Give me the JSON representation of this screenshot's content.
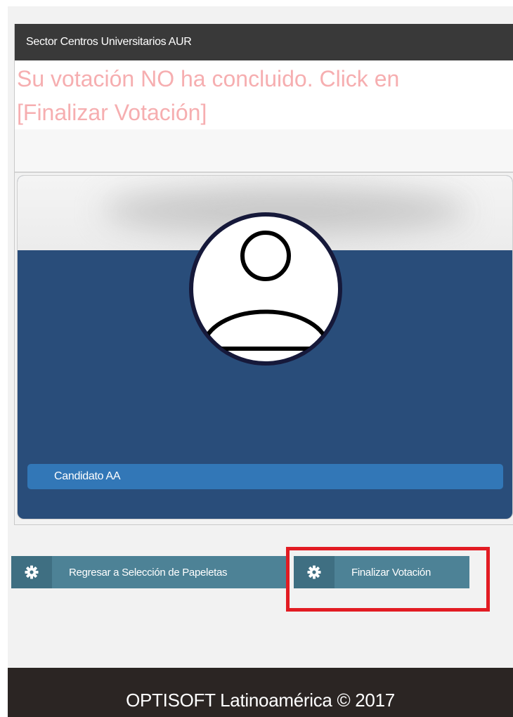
{
  "panel": {
    "header_title": "Sector Centros Universitarios AUR",
    "notice_line1": "Su votación NO ha concluido. Click en",
    "notice_line2": "[Finalizar Votación]"
  },
  "candidate": {
    "name": "Candidato AA",
    "avatar_icon": "user-avatar-icon"
  },
  "buttons": {
    "back_label": "Regresar a Selección de Papeletas",
    "back_icon": "gear-icon",
    "finish_label": "Finalizar Votación",
    "finish_icon": "gear-icon"
  },
  "footer": {
    "text": "OPTISOFT Latinoamérica © 2017"
  },
  "colors": {
    "header_bg": "#393939",
    "notice_text": "#f6aeb0",
    "card_bg": "#294d7a",
    "candidate_bar": "#3277b7",
    "button_bg": "#4d8296",
    "highlight": "#e21c23",
    "footer_bg": "#2b2523"
  }
}
